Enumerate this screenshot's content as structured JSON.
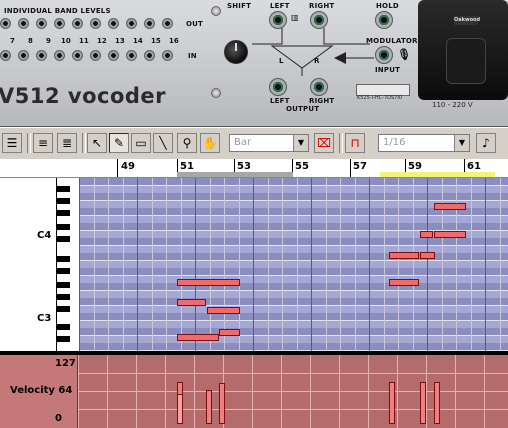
{
  "rack": {
    "band_levels_label": "INDIVIDUAL BAND LEVELS",
    "out_label": "OUT",
    "in_label": "IN",
    "band_numbers": [
      "7",
      "8",
      "9",
      "10",
      "11",
      "12",
      "13",
      "14",
      "15",
      "16"
    ],
    "shift_label": "SHIFT",
    "left_label": "LEFT",
    "right_label": "RIGHT",
    "l_label": "L",
    "r_label": "R",
    "left2_label": "LEFT",
    "right2_label": "RIGHT",
    "output_label": "OUTPUT",
    "hold_label": "HOLD",
    "modulator_label": "MODULATOR",
    "input_label": "INPUT",
    "brand": "V512 vocoder",
    "serial": "K525-I-HC-7DS7I0",
    "voltage": "110 - 220 V",
    "power_tag": "Oakwood"
  },
  "toolbar": {
    "quantize_value": "Bar",
    "grid_value": "1/16",
    "note_icon": "♪"
  },
  "ruler": {
    "bars": [
      "49",
      "51",
      "53",
      "55",
      "57",
      "59",
      "61"
    ]
  },
  "roll": {
    "c4_label": "C4",
    "c3_label": "C3"
  },
  "velocity": {
    "max_label": "127",
    "mid_label": "Velocity 64",
    "min_label": "0"
  }
}
